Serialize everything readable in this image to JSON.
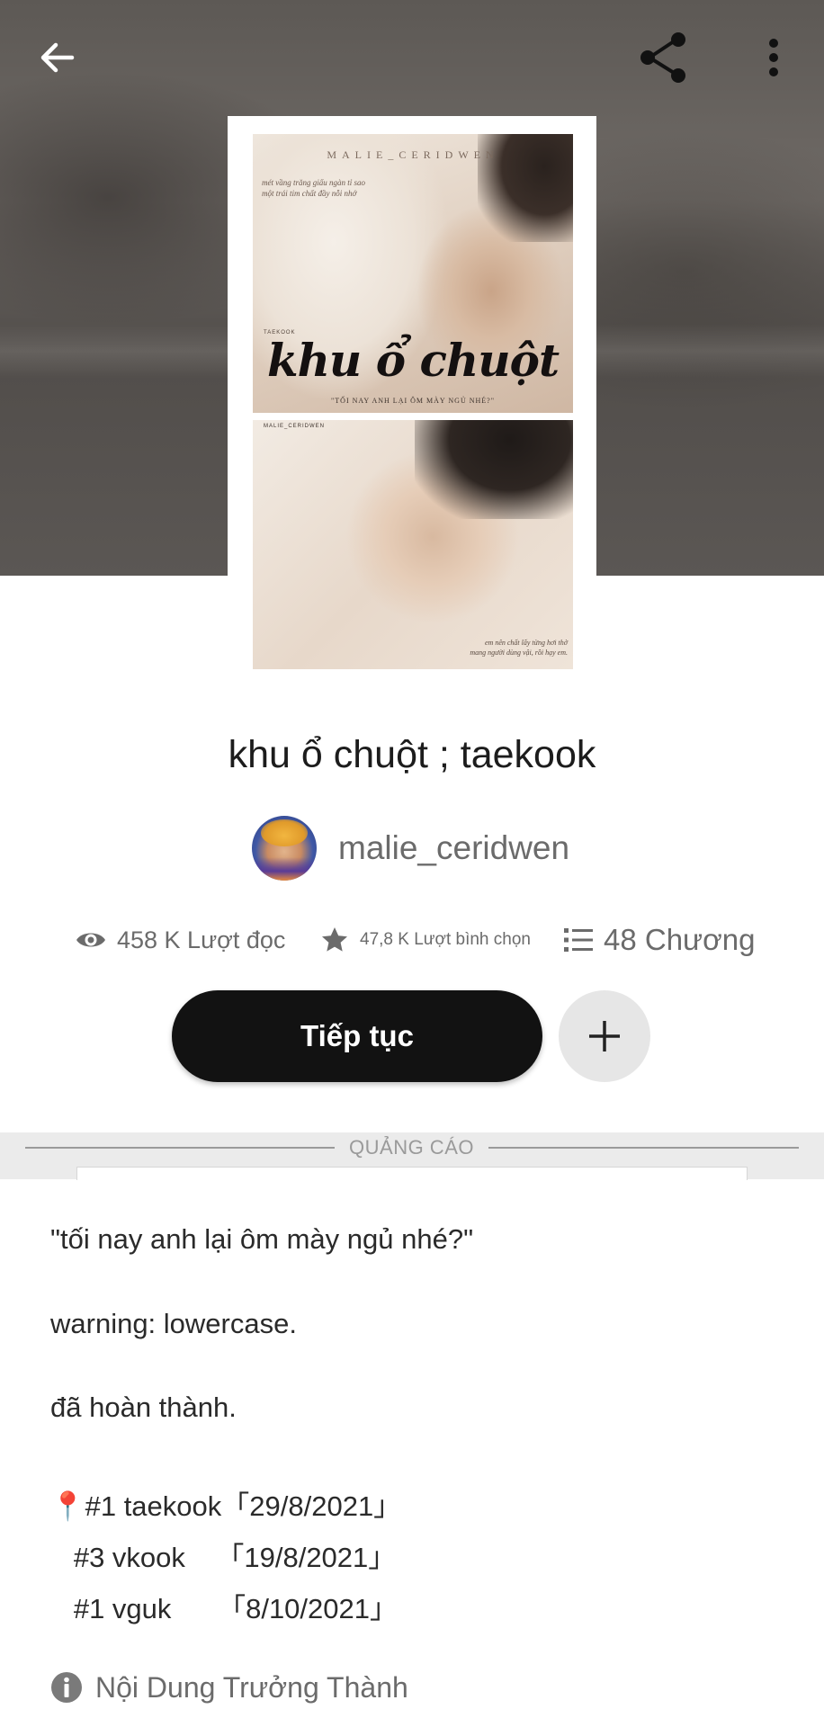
{
  "header": {
    "back_icon": "arrow-left-icon",
    "share_icon": "share-icon",
    "more_icon": "more-vertical-icon"
  },
  "cover": {
    "author_text": "MALIE_CERIDWEN",
    "quote_top": "mét vầng trăng giấu ngàn tỉ sao\nmột trái tim chất đầy nỗi nhớ",
    "tag_small": "TAEKOOK",
    "title_text": "khu ổ chuột",
    "subtitle_text": "\"TỐI NAY ANH LẠI ÔM MÀY NGỦ NHÉ?\"",
    "author_small": "MALIE_CERIDWEN",
    "quote_bottom": "em nên chất lấy từng hơi thở\nmang người dùng vậi, rồi hạy em."
  },
  "story": {
    "title": "khu ổ chuột ; taekook",
    "author": "malie_ceridwen"
  },
  "stats": {
    "reads": "458 K Lượt đọc",
    "votes": "47,8 K Lượt bình chọn",
    "parts": "48 Chương"
  },
  "actions": {
    "continue_label": "Tiếp tục",
    "add_icon": "plus-icon"
  },
  "ad": {
    "label": "QUẢNG CÁO"
  },
  "description": {
    "line1": "\"tối nay anh lại ôm mày ngủ nhé?\"",
    "line2": "warning: lowercase.",
    "line3": "đã hoàn thành.",
    "tags": [
      "📍#1 taekook「29/8/2021」",
      "   #3 vkook    「19/8/2021」",
      "   #1 vguk      「8/10/2021」"
    ]
  },
  "mature": {
    "label": "Nội Dung Trưởng Thành",
    "icon": "info-icon"
  },
  "colors": {
    "button_dark": "#121212",
    "muted_text": "#6b6b6b",
    "ad_bg": "#ebebeb"
  }
}
